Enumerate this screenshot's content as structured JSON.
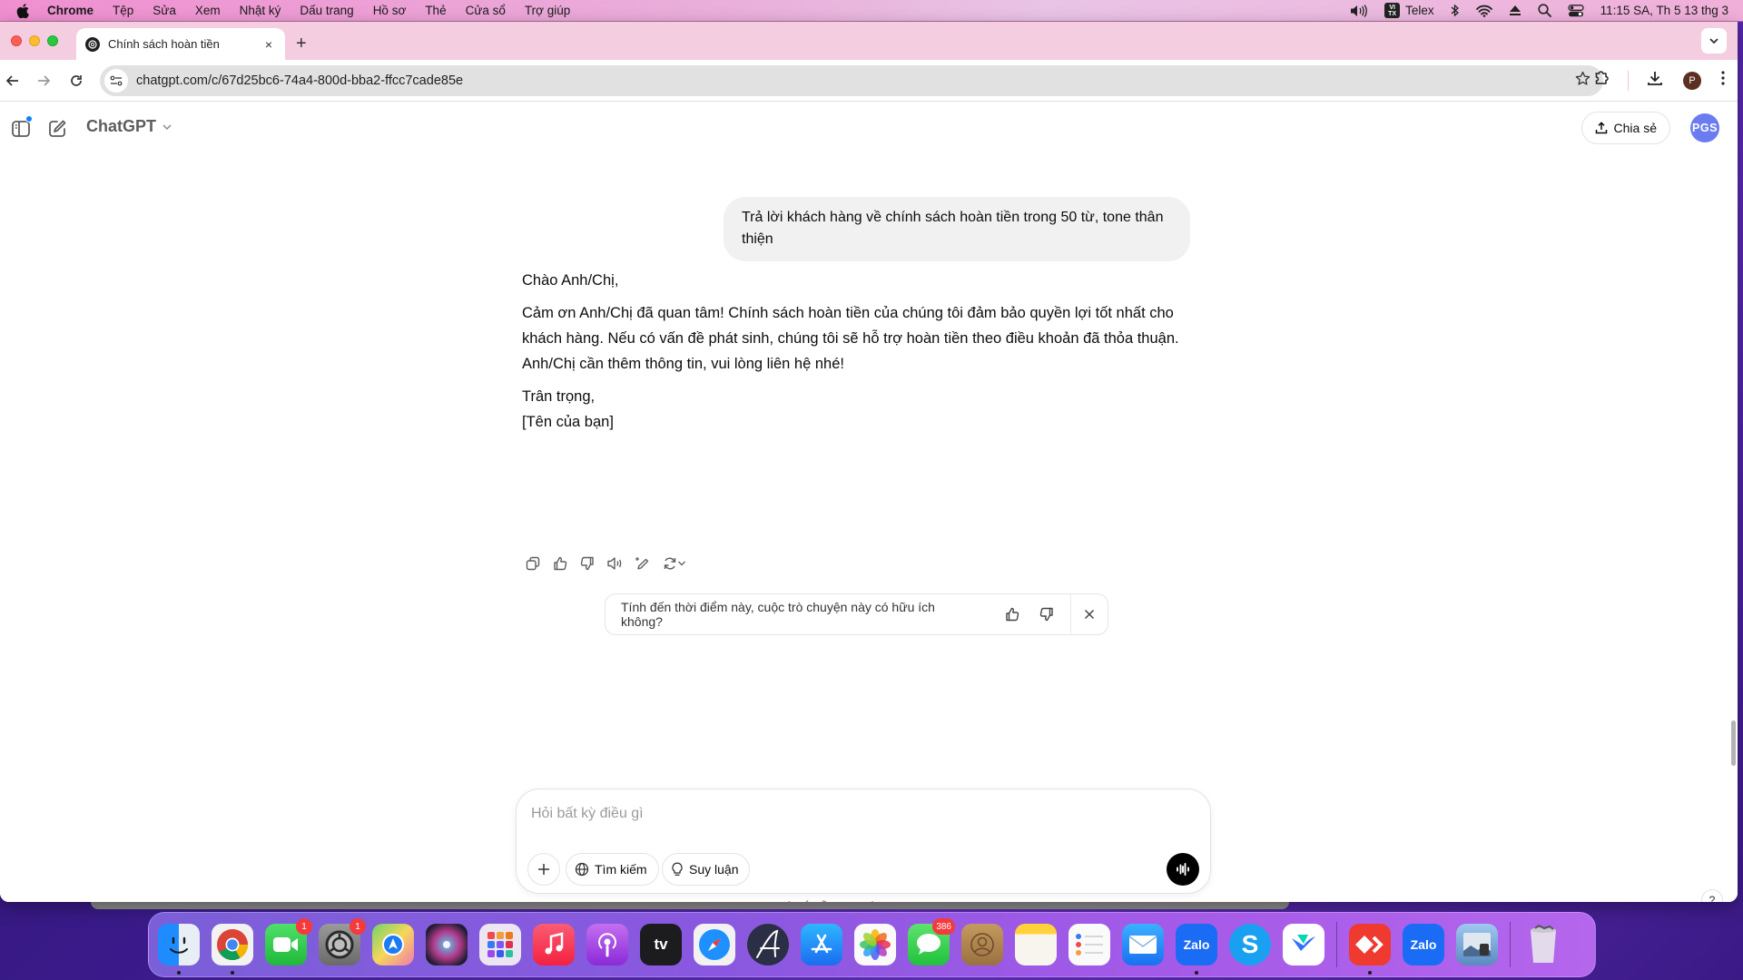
{
  "menubar": {
    "app_name": "Chrome",
    "items": [
      "Tệp",
      "Sửa",
      "Xem",
      "Nhật ký",
      "Dấu trang",
      "Hồ sơ",
      "Thẻ",
      "Cửa sổ",
      "Trợ giúp"
    ],
    "input_method": "Telex",
    "input_badge_top": "VI",
    "input_badge_bottom": "TX",
    "clock": "11:15 SA, Th 5 13 thg 3"
  },
  "browser": {
    "tab_title": "Chính sách hoàn tiền",
    "tab_close": "×",
    "new_tab": "+",
    "url": "chatgpt.com/c/67d25bc6-74a4-800d-bba2-ffcc7cade85e",
    "profile_initial": "P"
  },
  "chatgpt": {
    "model_title": "ChatGPT",
    "share_label": "Chia sẻ",
    "avatar_initials": "PGS",
    "user_message": "Trả lời khách hàng về chính sách hoàn tiền trong 50 từ, tone thân thiện",
    "assistant": {
      "greeting": "Chào Anh/Chị,",
      "body": "Cảm ơn Anh/Chị đã quan tâm! Chính sách hoàn tiền của chúng tôi đảm bảo quyền lợi tốt nhất cho khách hàng. Nếu có vấn đề phát sinh, chúng tôi sẽ hỗ trợ hoàn tiền theo điều khoản đã thỏa thuận. Anh/Chị cần thêm thông tin, vui lòng liên hệ nhé!",
      "signoff": "Trân trọng,",
      "signature": "[Tên của bạn]"
    },
    "feedback_prompt": "Tính đến thời điểm này, cuộc trò chuyện này có hữu ích không?",
    "composer": {
      "placeholder": "Hỏi bất kỳ điều gì",
      "value": "",
      "search_label": "Tìm kiếm",
      "reason_label": "Suy luận"
    },
    "disclaimer": "ChatGPT có thể mắc lỗi. Hãy kiểm tra các thông tin quan trọng.",
    "help_label": "?"
  },
  "dock": {
    "apps": [
      {
        "name": "Finder",
        "running": true
      },
      {
        "name": "Chrome",
        "running": true
      },
      {
        "name": "FaceTime",
        "badge": "1"
      },
      {
        "name": "System Settings",
        "badge": "1"
      },
      {
        "name": "Maps"
      },
      {
        "name": "Siri"
      },
      {
        "name": "Launchpad"
      },
      {
        "name": "Music"
      },
      {
        "name": "Podcasts"
      },
      {
        "name": "Apple TV",
        "label": "tv"
      },
      {
        "name": "Safari"
      },
      {
        "name": "Script Editor"
      },
      {
        "name": "App Store"
      },
      {
        "name": "Photos"
      },
      {
        "name": "Messages",
        "badge": "386"
      },
      {
        "name": "Contacts"
      },
      {
        "name": "Notes"
      },
      {
        "name": "Reminders"
      },
      {
        "name": "Mail"
      },
      {
        "name": "Zalo",
        "label": "Zalo",
        "running": true
      },
      {
        "name": "Skype",
        "label": "S"
      },
      {
        "name": "Lark"
      },
      {
        "name": "AnyDesk",
        "running": true
      },
      {
        "name": "Zalo",
        "label": "Zalo"
      },
      {
        "name": "Preview"
      },
      {
        "name": "Trash"
      }
    ]
  }
}
